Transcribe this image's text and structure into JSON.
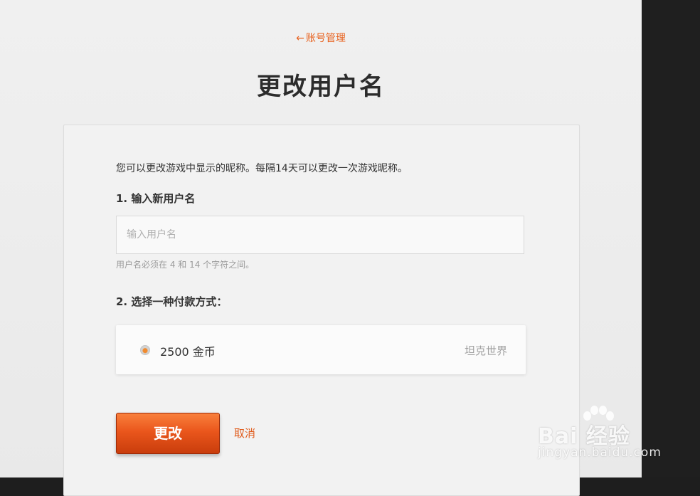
{
  "header": {
    "back_arrow": "←",
    "back_label": "账号管理",
    "title": "更改用户名"
  },
  "form": {
    "description": "您可以更改游戏中显示的昵称。每隔14天可以更改一次游戏昵称。",
    "step1_label": "1. 输入新用户名",
    "username": {
      "value": "",
      "placeholder": "输入用户名"
    },
    "hint": "用户名必须在 4 和 14 个字符之间。",
    "step2_label": "2. 选择一种付款方式：",
    "payment_option": {
      "label": "2500 金币",
      "game": "坦克世界",
      "selected": true
    },
    "submit_label": "更改",
    "cancel_label": "取消"
  },
  "watermark": {
    "brand": "Bai  经验",
    "url": "jingyan.baidu.com"
  },
  "colors": {
    "accent": "#e8621f",
    "button_top": "#f9803c",
    "button_bottom": "#c93d0c",
    "title_text": "#2c2c2c",
    "muted_text": "#9a9a9a"
  },
  "icons": {
    "back": "arrow-left-icon",
    "radio": "radio-selected-icon",
    "watermark": "baidu-paw-logo"
  }
}
